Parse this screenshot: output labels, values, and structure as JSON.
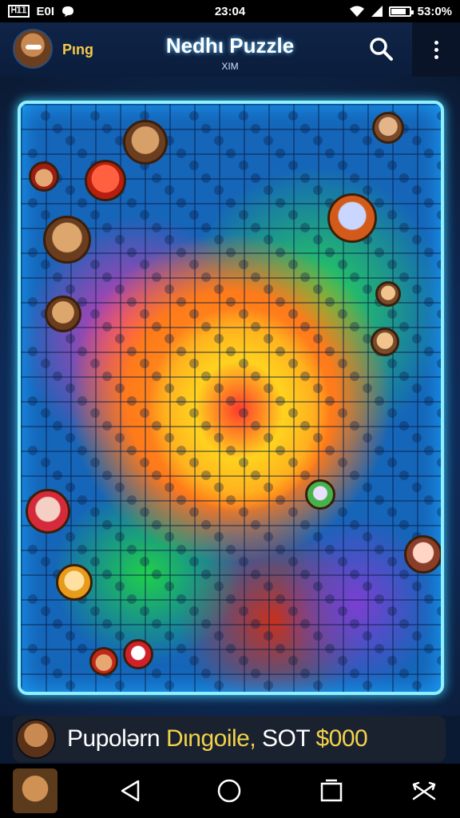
{
  "status_bar": {
    "sim_label": "Ꮋ𝟙𝟙",
    "carrier": "E0I",
    "time": "23:04",
    "battery_text": "53:0%",
    "battery_level": 0.8
  },
  "header": {
    "player_name": "Pιnɡ",
    "title": "Nedhι Puzzle",
    "subtitle": "XIM",
    "search_icon": "search-icon",
    "more_icon": "more-vert-icon"
  },
  "board": {
    "border_color": "#8ff0ff",
    "image": "jigsaw-puzzle-artwork"
  },
  "banner": {
    "text_plain": "Pupolərn ",
    "text_gold_1": "Dιngoile,",
    "text_mid": " SOT ",
    "text_gold_2": "$000"
  },
  "nav": {
    "back_icon": "back-triangle-icon",
    "home_icon": "home-circle-icon",
    "recents_icon": "recents-square-icon",
    "extra_icon": "crossed-arrows-icon"
  }
}
